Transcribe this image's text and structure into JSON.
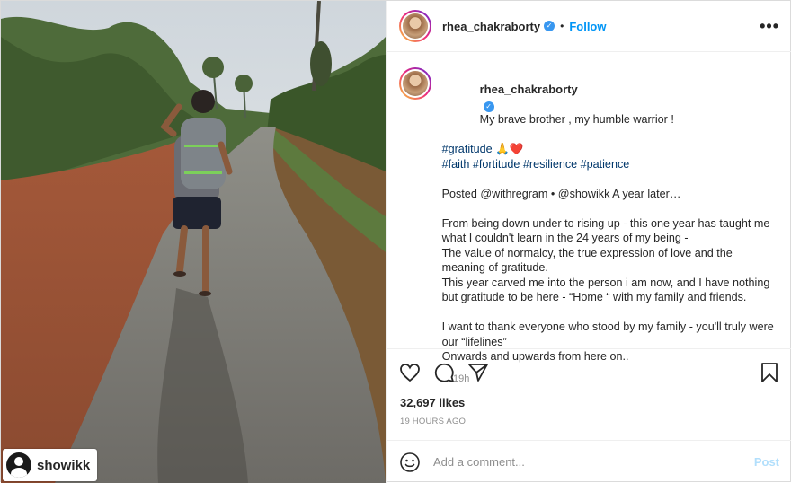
{
  "photo": {
    "tag": {
      "username": "showikk"
    }
  },
  "header": {
    "username": "rhea_chakraborty",
    "verified_icon": "verified-badge-icon",
    "separator": "•",
    "follow_label": "Follow",
    "more_icon": "more-options-icon"
  },
  "caption": {
    "username": "rhea_chakraborty",
    "first_line": "My brave brother , my humble warrior !",
    "lines": [
      "",
      "#gratitude 🙏❤️",
      "#faith #fortitude #resilience #patience",
      "",
      "Posted @withregram • @showikk A year later…",
      "",
      "From being down under to rising up - this one year has taught me what I couldn't learn in the 24 years of my being -",
      "The value of normalcy, the true expression of love and the meaning of gratitude.",
      "This year carved me into the person i am now, and I have nothing but gratitude to be here - “Home “ with my family and friends.",
      "",
      "I want to thank everyone who stood by my family - you'll truly were our “lifelines”",
      "Onwards and upwards from here on.."
    ],
    "time": "19h"
  },
  "actions": {
    "like_icon": "heart-icon",
    "comment_icon": "comment-icon",
    "share_icon": "share-icon",
    "save_icon": "bookmark-icon"
  },
  "likes": "32,697 likes",
  "posted_ago": "19 HOURS AGO",
  "comment": {
    "emoji_icon": "emoji-icon",
    "placeholder": "Add a comment...",
    "post_label": "Post"
  },
  "colors": {
    "accent": "#0095f6",
    "link": "#00376b",
    "muted": "#8e8e8e",
    "post_disabled": "#b2dffc"
  }
}
